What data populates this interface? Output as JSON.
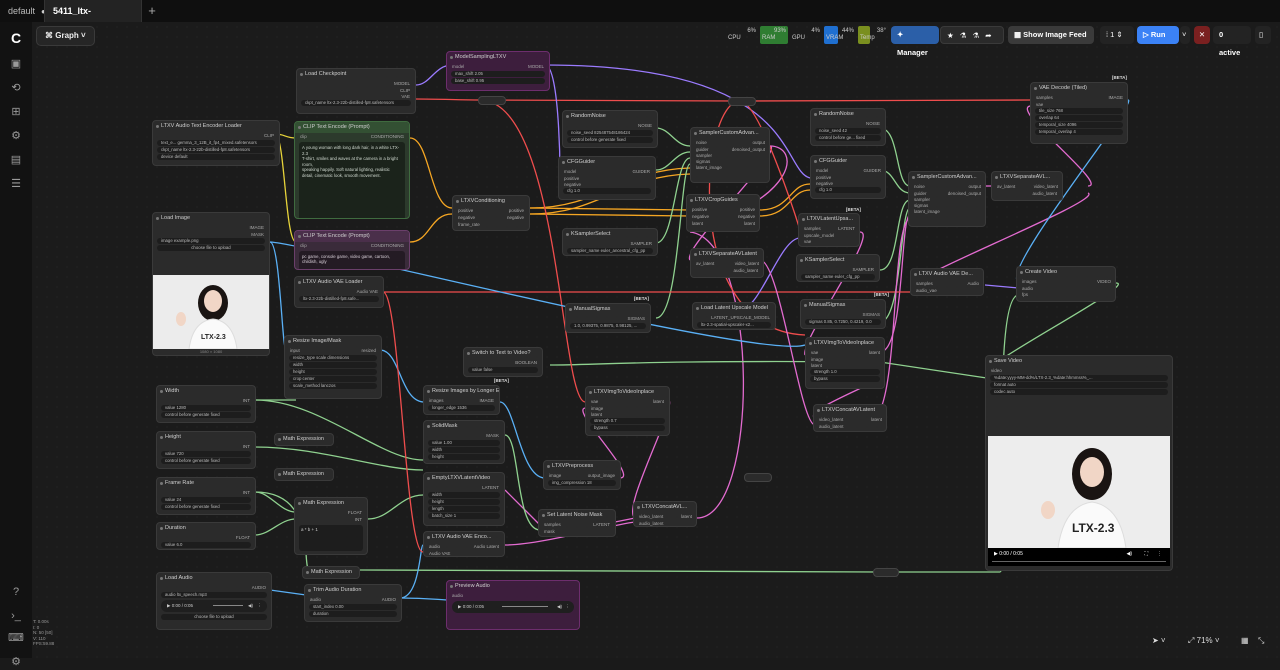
{
  "tabs": [
    {
      "label": "default",
      "active": false
    },
    {
      "label": "5411_ltx-2.3_ia2v_di...",
      "active": true
    }
  ],
  "graph_label": "Graph",
  "stats": {
    "cpu_label": "CPU",
    "cpu_pct": "6%",
    "ram_label": "RAM",
    "ram_pct": "93%",
    "gpu_label": "GPU",
    "gpu_pct": "4%",
    "vram_label": "VRAM",
    "vram_pct": "44%",
    "temp_label": "Temp",
    "temp": "38°"
  },
  "manager_label": "Manager",
  "show_image_feed_label": "Show Image Feed",
  "queue_count": "1",
  "run_label": "Run",
  "active_label": "0 active",
  "zoom": "71%",
  "coords_text": "T: 0.00s\nI: 0\nN: 50 [50]\nV: 110\nFPS:59.88",
  "nodes": {
    "load_checkpoint": {
      "title": "Load Checkpoint",
      "out1": "MODEL",
      "out2": "CLIP",
      "out3": "VAE",
      "widget": "ckpt_name   ltx-2.3-22b-distilled-fp8.safetensors"
    },
    "ltxv_audio_text_encoder": {
      "title": "LTXV Audio Text Encoder Loader",
      "out": "CLIP",
      "w1": "text_e...   gemma_3_12B_it_fp4_mixed.safetensors",
      "w2": "ckpt_name   ltx-2.3-22b-distilled-fp8.safetensors",
      "w3": "device   default"
    },
    "clip_text_pos": {
      "title": "CLIP Text Encode (Prompt)",
      "in": "clip",
      "out": "CONDITIONING",
      "text": "A young woman with long dark hair, in a white LTX-2.3\nT-shirt, smiles and waves at the camera in a bright room,\nspeaking happily. Soft natural lighting, realistic\ndetail, cinematic look, smooth movement."
    },
    "clip_text_neg": {
      "title": "CLIP Text Encode (Prompt)",
      "in": "clip",
      "out": "CONDITIONING",
      "text": "pc game, console game, video game, cartoon, childish, ugly"
    },
    "load_image": {
      "title": "Load Image",
      "out1": "IMAGE",
      "out2": "MASK",
      "w1": "image   example.png",
      "w2": "choose file to upload",
      "caption": "1080 × 1080"
    },
    "ltxv_audio_vae_loader": {
      "title": "LTXV Audio VAE Loader",
      "out": "Audio VAE",
      "w": "ltx-2.3-22b-distilled-fp8.safe..."
    },
    "resize_image_mask": {
      "title": "Resize Image/Mask",
      "in": "input",
      "out": "resized",
      "w1": "resize_type   scale dimensions",
      "w2": "width",
      "w3": "height",
      "w4": "crop   center",
      "w5": "scale_method   lanczos"
    },
    "width": {
      "title": "Width",
      "out": "INT",
      "w1": "value   1280",
      "w2": "control before generate   fixed"
    },
    "height": {
      "title": "Height",
      "out": "INT",
      "w1": "value   720",
      "w2": "control before generate   fixed"
    },
    "frame_rate": {
      "title": "Frame Rate",
      "out": "INT",
      "w1": "value   24",
      "w2": "control before generate   fixed"
    },
    "duration": {
      "title": "Duration",
      "out": "FLOAT",
      "w1": "value   6.0"
    },
    "math_expr_top": {
      "title": "Math Expression",
      "out1": "FLOAT",
      "out2": "INT",
      "w": "a * b + 1"
    },
    "math_expr_small1": {
      "title": "Math Expression"
    },
    "math_expr_small2": {
      "title": "Math Expression"
    },
    "math_expr_bottom": {
      "title": "Math Expression"
    },
    "load_audio": {
      "title": "Load Audio",
      "out": "AUDIO",
      "w1": "audio   ltx_speech.mp3",
      "time": "0:00 / 0:05",
      "w2": "choose file to upload"
    },
    "trim_audio": {
      "title": "Trim Audio Duration",
      "in": "audio",
      "out": "AUDIO",
      "w1": "start_index   0.00",
      "w2": "duration"
    },
    "ltxv_conditioning": {
      "title": "LTXVConditioning",
      "in1": "positive",
      "in2": "negative",
      "in3": "frame_rate",
      "out1": "positive",
      "out2": "negative"
    },
    "random_noise_1": {
      "title": "RandomNoise",
      "out": "NOISE",
      "w1": "noise_seed   825487548186424",
      "w2": "control before generate   fixed"
    },
    "cfg_guider_1": {
      "title": "CFGGuider",
      "in1": "model",
      "in2": "positive",
      "in3": "negative",
      "out": "GUIDER",
      "w": "cfg   1.0"
    },
    "ksampler_select_1": {
      "title": "KSamplerSelect",
      "out": "SAMPLER",
      "w": "sampler_name   euler_ancestral_cfg_pp"
    },
    "manual_sigmas_1": {
      "title": "ManualSigmas",
      "out": "SIGMAS",
      "w": "1.0, 0.99375, 0.9875, 0.98125, ..."
    },
    "switch_node": {
      "title": "Switch to Text to Video?",
      "out": "BOOLEAN",
      "w": "value   false"
    },
    "resize_longer": {
      "title": "Resize Images by Longer Edge",
      "in": "images",
      "out": "IMAGE",
      "w": "longer_edge   1536"
    },
    "solid_mask": {
      "title": "SolidMask",
      "out": "MASK",
      "w1": "value   1.00",
      "w2": "width",
      "w3": "height"
    },
    "empty_latent_video": {
      "title": "EmptyLTXVLatentVideo",
      "out": "LATENT",
      "w1": "width",
      "w2": "height",
      "w3": "length",
      "w4": "batch_size   1"
    },
    "ltxv_audio_vae_encode": {
      "title": "LTXV Audio VAE Enco...",
      "in1": "audio",
      "in2": "Audio VAE",
      "out": "Audio Latent"
    },
    "ltxv_preprocess": {
      "title": "LTXVPreprocess",
      "in": "image",
      "out": "output_image",
      "w": "img_compression   18"
    },
    "ltxv_img_to_video_1": {
      "title": "LTXVImgToVideoInplace",
      "in1": "vae",
      "in2": "image",
      "in3": "latent",
      "out": "latent",
      "w1": "strength   0.7",
      "w2": "bypass"
    },
    "set_latent_noise_mask": {
      "title": "Set Latent Noise Mask",
      "in1": "samples",
      "in2": "mask",
      "out": "LATENT"
    },
    "ltxv_concat_1": {
      "title": "LTXVConcatAVL...",
      "in1": "video_latent",
      "in2": "audio_latent",
      "out": "latent"
    },
    "sampler_custom_1": {
      "title": "SamplerCustomAdvan...",
      "in1": "noise",
      "in2": "guider",
      "in3": "sampler",
      "in4": "sigmas",
      "in5": "latent_image",
      "out1": "output",
      "out2": "denoised_output"
    },
    "ltxv_crop_guides": {
      "title": "LTXVCropGuides",
      "in1": "positive",
      "in2": "negative",
      "in3": "latent",
      "out1": "positive",
      "out2": "negative",
      "out3": "latent"
    },
    "ltxv_separate_1": {
      "title": "LTXVSeparateAVLatent",
      "in": "av_latent",
      "out1": "video_latent",
      "out2": "audio_latent"
    },
    "load_latent_upscale": {
      "title": "Load Latent Upscale Model",
      "out": "LATENT_UPSCALE_MODEL",
      "w": "ltx-2.3-spatial-upscaler-x2..."
    },
    "random_noise_2": {
      "title": "RandomNoise",
      "out": "NOISE",
      "w1": "noise_seed   42",
      "w2": "control before ge...   fixed"
    },
    "cfg_guider_2": {
      "title": "CFGGuider",
      "in1": "model",
      "in2": "positive",
      "in3": "negative",
      "out": "GUIDER",
      "w": "cfg   1.0"
    },
    "ltxv_latent_upsampler": {
      "title": "LTXVLatentUpsa...",
      "in1": "samples",
      "in2": "upscale_model",
      "in3": "vae",
      "out": "LATENT"
    },
    "ksampler_select_2": {
      "title": "KSamplerSelect",
      "out": "SAMPLER",
      "w": "sampler_name   euler_cfg_pp"
    },
    "manual_sigmas_2": {
      "title": "ManualSigmas",
      "out": "SIGMAS",
      "w": "sigmas   0.85, 0.7250, 0.4219, 0.0"
    },
    "ltxv_img_to_video_2": {
      "title": "LTXVImgToVideoInplace",
      "in1": "vae",
      "in2": "image",
      "in3": "latent",
      "out": "latent",
      "w1": "strength   1.0",
      "w2": "bypass"
    },
    "ltxv_concat_2": {
      "title": "LTXVConcatAVLatent",
      "in1": "video_latent",
      "in2": "audio_latent",
      "out": "latent"
    },
    "sampler_custom_2": {
      "title": "SamplerCustomAdvan...",
      "in1": "noise",
      "in2": "guider",
      "in3": "sampler",
      "in4": "sigmas",
      "in5": "latent_image",
      "out1": "output",
      "out2": "denoised_output"
    },
    "ltxv_separate_2": {
      "title": "LTXVSeparateAVL...",
      "in": "av_latent",
      "out1": "video_latent",
      "out2": "audio_latent"
    },
    "vae_decode_tiled": {
      "title": "VAE Decode (Tiled)",
      "in1": "samples",
      "in2": "vae",
      "out": "IMAGE",
      "w1": "tile_size   768",
      "w2": "overlap   64",
      "w3": "temporal_size   4096",
      "w4": "temporal_overlap   4"
    },
    "ltxv_audio_vae_decode": {
      "title": "LTXV Audio VAE De...",
      "in1": "samples",
      "in2": "audio_vae",
      "out": "Audio"
    },
    "create_video": {
      "title": "Create Video",
      "in1": "images",
      "in2": "audio",
      "in3": "fps",
      "out": "VIDEO"
    },
    "save_video": {
      "title": "Save Video",
      "in": "video",
      "w1": "%date:yyyy-MM-dd%/LTX-2.3_%date:hhmmss%_...",
      "w2": "format   auto",
      "w3": "codec   auto",
      "time": "0:00 / 0:05"
    },
    "audio_preview": {
      "title": "Preview Audio",
      "in": "audio",
      "time": "0:00 / 0:05"
    },
    "model_sampling": {
      "title": "ModelSamplingLTXV",
      "in": "model",
      "out": "MODEL",
      "w1": "max_shift   2.05",
      "w2": "base_shift   0.95"
    }
  },
  "beta_label": "[BETA]",
  "ltx_watermark": "LTX-2.3",
  "colors": {
    "accent": "#2b6fd6",
    "run": "#3b82f6",
    "wire_pink": "#e36bd0",
    "wire_orange": "#f5a623",
    "wire_yellow": "#e6d33a",
    "wire_green": "#8fd18f",
    "wire_red": "#ef4d4d",
    "wire_purple": "#9b7bff",
    "wire_blue": "#5ab0f5"
  }
}
